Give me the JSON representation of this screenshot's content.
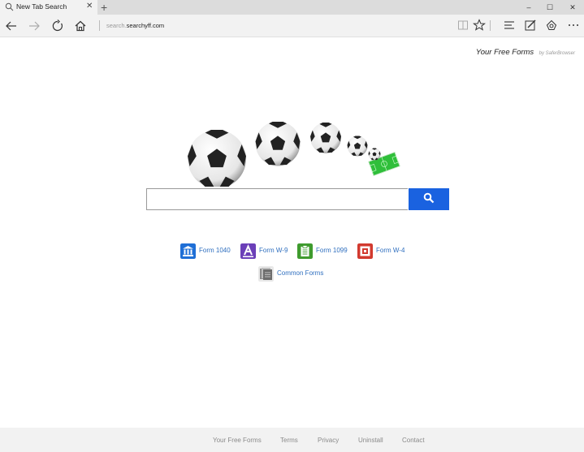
{
  "browser": {
    "tab_title": "New Tab Search",
    "new_tab_symbol": "+",
    "address_prefix": "search.",
    "address_host": "searchyff.com",
    "window": {
      "minimize": "–",
      "maximize": "☐",
      "close": "✕"
    }
  },
  "brand": {
    "name": "Your Free Forms",
    "by": "by SaferBrowser"
  },
  "search": {
    "value": "",
    "placeholder": ""
  },
  "forms": [
    {
      "label": "Form 1040",
      "icon": "bank-icon",
      "color": "#1f6fd6"
    },
    {
      "label": "Form W-9",
      "icon": "letter-a-icon",
      "color": "#6b3fb8"
    },
    {
      "label": "Form 1099",
      "icon": "clipboard-icon",
      "color": "#3f9b2e"
    },
    {
      "label": "Form W-4",
      "icon": "document-icon",
      "color": "#d23a2f"
    },
    {
      "label": "Common Forms",
      "icon": "forms-stack-icon",
      "color": "#777777"
    }
  ],
  "footer": [
    "Your Free Forms",
    "Terms",
    "Privacy",
    "Uninstall",
    "Contact"
  ],
  "colors": {
    "accent": "#1a62e0",
    "link": "#2f6fbf"
  }
}
